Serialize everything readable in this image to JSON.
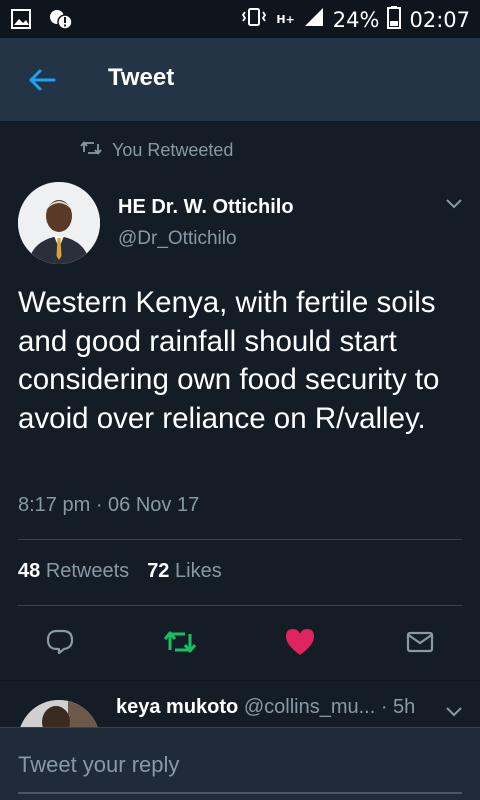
{
  "status_bar": {
    "battery": "24%",
    "time": "02:07",
    "network": "H+"
  },
  "app_bar": {
    "title": "Tweet"
  },
  "tweet": {
    "context": "You Retweeted",
    "author_name": "HE Dr. W. Ottichilo",
    "author_handle": "@Dr_Ottichilo",
    "text": "Western Kenya, with fertile soils and good rainfall should start considering own food security to avoid over reliance on R/valley.",
    "timestamp": "8:17 pm · 06 Nov 17",
    "retweets_count": "48",
    "retweets_label": "Retweets",
    "likes_count": "72",
    "likes_label": "Likes"
  },
  "actions": [
    {
      "name": "reply",
      "icon": "reply-icon"
    },
    {
      "name": "retweet",
      "icon": "retweet-icon"
    },
    {
      "name": "like",
      "icon": "heart-icon"
    },
    {
      "name": "share",
      "icon": "mail-icon"
    }
  ],
  "reply_preview": {
    "author_name": "keya mukoto",
    "meta": "@collins_mu... · 5h"
  },
  "compose": {
    "placeholder": "Tweet your reply"
  },
  "colors": {
    "background": "#141d26",
    "app_bar": "#243447",
    "muted_text": "#8899a6",
    "accent_blue": "#1da1f2",
    "retweet_green": "#17bf63",
    "like_red": "#e0245e"
  }
}
